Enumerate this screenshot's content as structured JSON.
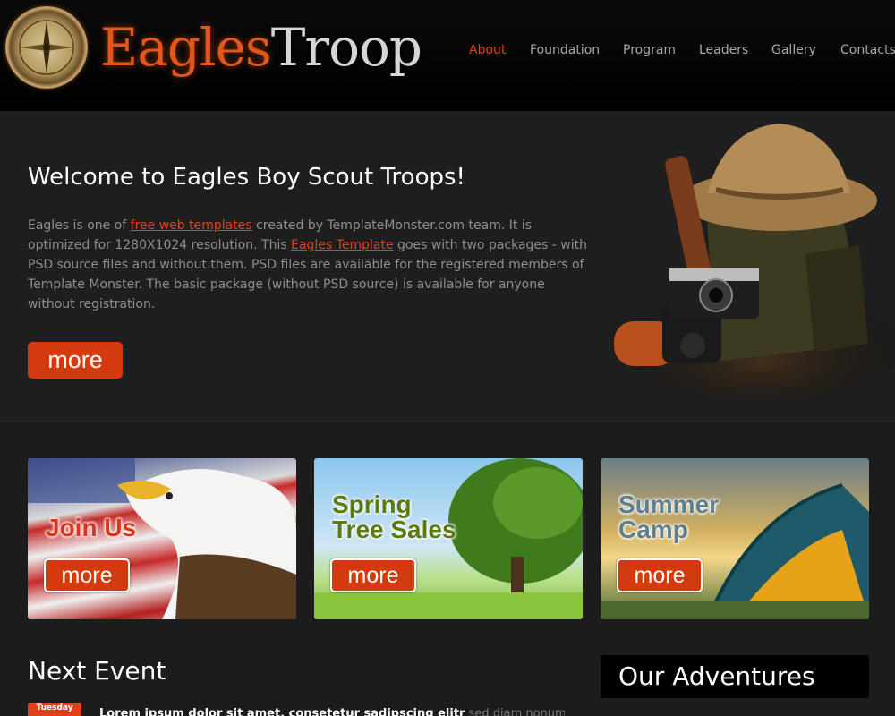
{
  "header": {
    "logo_part1": "Eagles",
    "logo_part2": "Troop",
    "nav": [
      {
        "label": "About",
        "active": true
      },
      {
        "label": "Foundation",
        "active": false
      },
      {
        "label": "Program",
        "active": false
      },
      {
        "label": "Leaders",
        "active": false
      },
      {
        "label": "Gallery",
        "active": false
      },
      {
        "label": "Contacts",
        "active": false
      }
    ]
  },
  "hero": {
    "title": "Welcome to Eagles Boy Scout Troops!",
    "text_1": "Eagles is one of ",
    "link_1": "free web templates",
    "text_2": " created by TemplateMonster.com team. It is optimized for 1280X1024 resolution. This ",
    "link_2": "Eagles Template",
    "text_3": " goes with two packages - with PSD source files and without them. PSD files are available for the registered members of Template Monster. The basic package (without PSD source) is available for anyone without registration.",
    "button": "more"
  },
  "tiles": [
    {
      "title": "Join Us",
      "button": "more"
    },
    {
      "title": "Spring\nTree Sales",
      "button": "more"
    },
    {
      "title": "Summer\nCamp",
      "button": "more"
    }
  ],
  "next_event": {
    "heading": "Next Event",
    "calendar_day": "Tuesday",
    "text": "Lorem ipsum dolor sit amet, consetetur sadipscing elitr",
    "text_dim": " sed diam nonumy"
  },
  "adventures": {
    "heading": "Our Adventures"
  },
  "colors": {
    "accent": "#e0401a",
    "button": "#d53a0e",
    "background": "#1c1c1c"
  }
}
